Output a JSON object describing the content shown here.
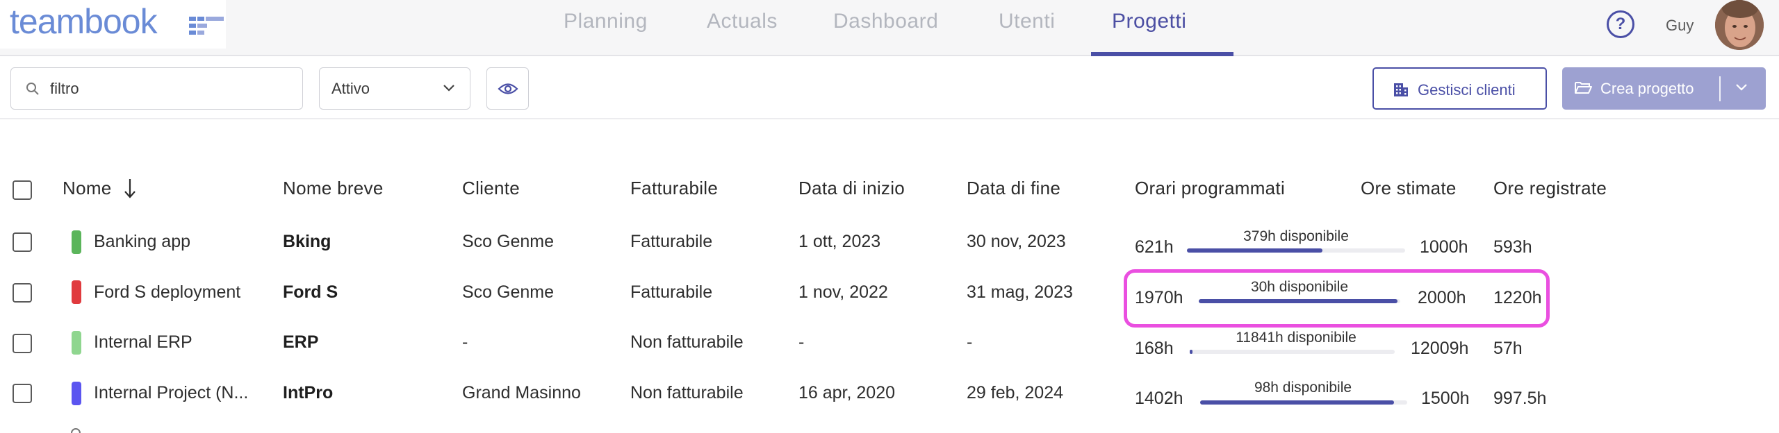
{
  "logo": {
    "text": "teambook"
  },
  "nav": {
    "items": [
      {
        "label": "Planning"
      },
      {
        "label": "Actuals"
      },
      {
        "label": "Dashboard"
      },
      {
        "label": "Utenti"
      },
      {
        "label": "Progetti"
      }
    ],
    "active": "Progetti"
  },
  "user": {
    "help_symbol": "?",
    "name": "Guy"
  },
  "toolbar": {
    "search_value": "filtro",
    "status_filter": "Attivo",
    "manage_clients_label": "Gestisci clienti",
    "create_project_label": "Crea progetto"
  },
  "table": {
    "headers": {
      "name": "Nome",
      "short_name": "Nome breve",
      "client": "Cliente",
      "billable": "Fatturabile",
      "start_date": "Data di inizio",
      "end_date": "Data di fine",
      "scheduled": "Orari programmati",
      "estimated": "Ore stimate",
      "logged": "Ore registrate"
    },
    "rows": [
      {
        "color": "#5bb55b",
        "name": "Banking app",
        "short_name": "Bking",
        "client": "Sco Genme",
        "billable": "Fatturabile",
        "start_date": "1 ott, 2023",
        "end_date": "30 nov, 2023",
        "scheduled": "621h",
        "available": "379h disponibile",
        "progress": 0.62,
        "estimated": "1000h",
        "logged": "593h"
      },
      {
        "color": "#e03a3e",
        "name": "Ford S deployment",
        "short_name": "Ford S",
        "client": "Sco Genme",
        "billable": "Fatturabile",
        "start_date": "1 nov, 2022",
        "end_date": "31 mag, 2023",
        "scheduled": "1970h",
        "available": "30h disponibile",
        "progress": 0.985,
        "estimated": "2000h",
        "logged": "1220h"
      },
      {
        "color": "#8fd68f",
        "name": "Internal ERP",
        "short_name": "ERP",
        "client": "-",
        "billable": "Non fatturabile",
        "start_date": "-",
        "end_date": "-",
        "scheduled": "168h",
        "available": "11841h disponibile",
        "progress": 0.014,
        "estimated": "12009h",
        "logged": "57h"
      },
      {
        "color": "#5b55f0",
        "name": "Internal Project (N...",
        "short_name": "IntPro",
        "client": "Grand Masinno",
        "billable": "Non fatturabile",
        "start_date": "16 apr, 2020",
        "end_date": "29 feb, 2024",
        "scheduled": "1402h",
        "available": "98h disponibile",
        "progress": 0.935,
        "estimated": "1500h",
        "logged": "997.5h"
      }
    ]
  },
  "colors": {
    "accent": "#4a4fa6",
    "highlight": "#ea4fe0",
    "logo": "#6a8bd6"
  }
}
